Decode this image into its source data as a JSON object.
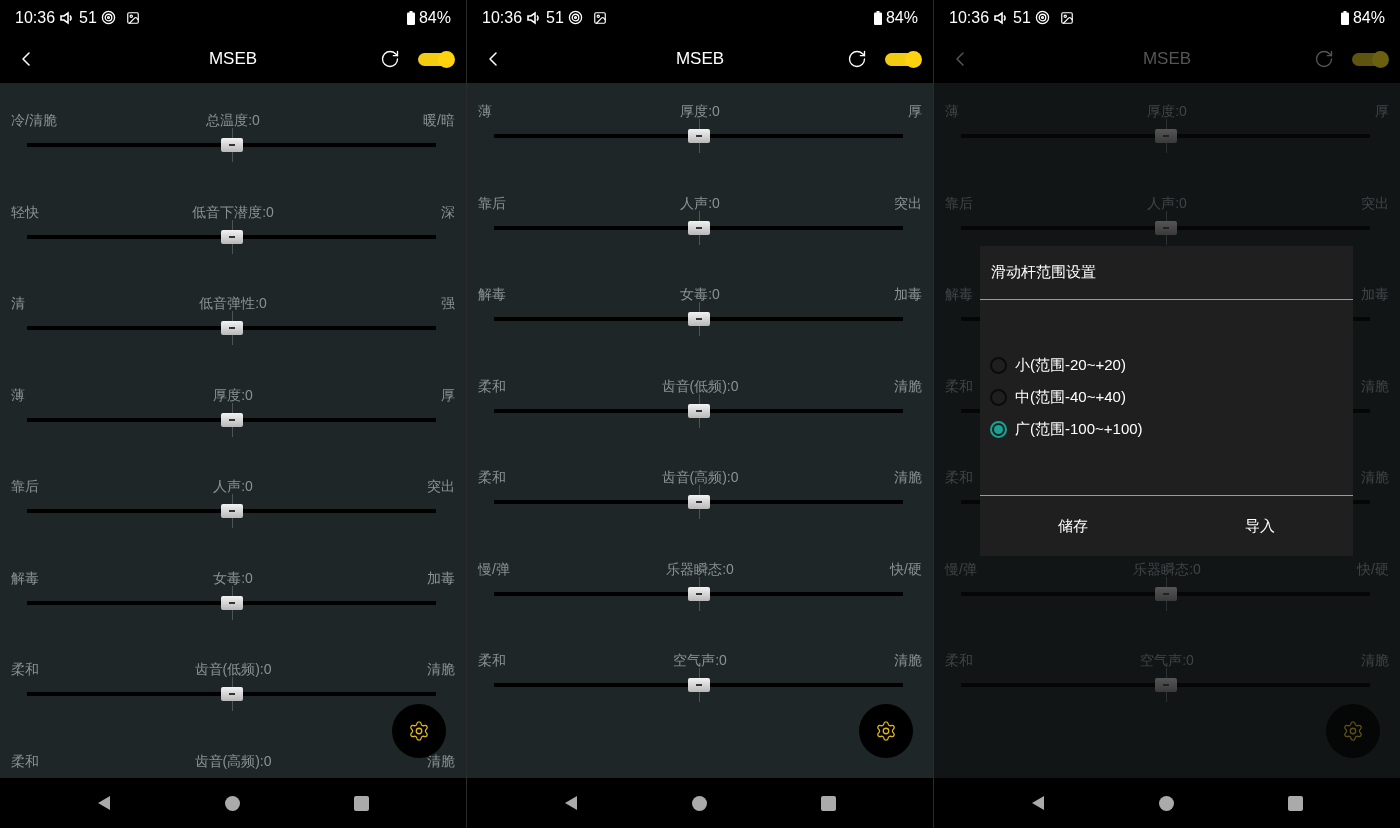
{
  "screens": [
    {
      "status_bar": {
        "time": "10:36",
        "volume": "51",
        "battery": "84%"
      },
      "title": "MSEB",
      "switch_on": true,
      "sliders": [
        {
          "kind": "slider",
          "left": "冷/清脆",
          "center": "总温度:0",
          "right": "暖/暗",
          "level": 0.5
        },
        {
          "kind": "slider",
          "left": "轻快",
          "center": "低音下潜度:0",
          "right": "深",
          "level": 0.5
        },
        {
          "kind": "slider",
          "left": "清",
          "center": "低音弹性:0",
          "right": "强",
          "level": 0.5
        },
        {
          "kind": "slider",
          "left": "薄",
          "center": "厚度:0",
          "right": "厚",
          "level": 0.5
        },
        {
          "kind": "slider",
          "left": "靠后",
          "center": "人声:0",
          "right": "突出",
          "level": 0.5
        },
        {
          "kind": "slider",
          "left": "解毒",
          "center": "女毒:0",
          "right": "加毒",
          "level": 0.5
        },
        {
          "kind": "slider",
          "left": "柔和",
          "center": "齿音(低频):0",
          "right": "清脆",
          "level": 0.5
        },
        {
          "kind": "labels",
          "left": "柔和",
          "center": "齿音(高频):0",
          "right": "清脆"
        }
      ]
    },
    {
      "status_bar": {
        "time": "10:36",
        "volume": "51",
        "battery": "84%"
      },
      "title": "MSEB",
      "switch_on": true,
      "sliders": [
        {
          "kind": "slider",
          "left": "薄",
          "center": "厚度:0",
          "right": "厚",
          "level": 0.5
        },
        {
          "kind": "slider",
          "left": "靠后",
          "center": "人声:0",
          "right": "突出",
          "level": 0.5
        },
        {
          "kind": "slider",
          "left": "解毒",
          "center": "女毒:0",
          "right": "加毒",
          "level": 0.5
        },
        {
          "kind": "slider",
          "left": "柔和",
          "center": "齿音(低频):0",
          "right": "清脆",
          "level": 0.5
        },
        {
          "kind": "slider",
          "left": "柔和",
          "center": "齿音(高频):0",
          "right": "清脆",
          "level": 0.5
        },
        {
          "kind": "slider",
          "left": "慢/弹",
          "center": "乐器瞬态:0",
          "right": "快/硬",
          "level": 0.5
        },
        {
          "kind": "slider",
          "left": "柔和",
          "center": "空气声:0",
          "right": "清脆",
          "level": 0.5
        }
      ]
    },
    {
      "status_bar": {
        "time": "10:36",
        "volume": "51",
        "battery": "84%"
      },
      "title": "MSEB",
      "switch_on": true,
      "sliders": [
        {
          "kind": "slider",
          "left": "薄",
          "center": "厚度:0",
          "right": "厚",
          "level": 0.5
        },
        {
          "kind": "slider",
          "left": "靠后",
          "center": "人声:0",
          "right": "突出",
          "level": 0.5
        },
        {
          "kind": "slider",
          "left": "解毒",
          "right": "加毒"
        },
        {
          "kind": "slider",
          "left": "柔和",
          "right": "清脆"
        },
        {
          "kind": "slider",
          "left": "柔和",
          "right": "清脆"
        },
        {
          "kind": "slider",
          "left": "慢/弹",
          "center": "乐器瞬态:0",
          "right": "快/硬",
          "level": 0.5
        },
        {
          "kind": "slider",
          "left": "柔和",
          "center": "空气声:0",
          "right": "清脆",
          "level": 0.5
        }
      ],
      "dialog": {
        "title": "滑动杆范围设置",
        "options": [
          {
            "label": "小(范围-20~+20)",
            "selected": false
          },
          {
            "label": "中(范围-40~+40)",
            "selected": false
          },
          {
            "label": "广(范围-100~+100)",
            "selected": true
          }
        ],
        "buttons": [
          "储存",
          "导入"
        ]
      }
    }
  ]
}
